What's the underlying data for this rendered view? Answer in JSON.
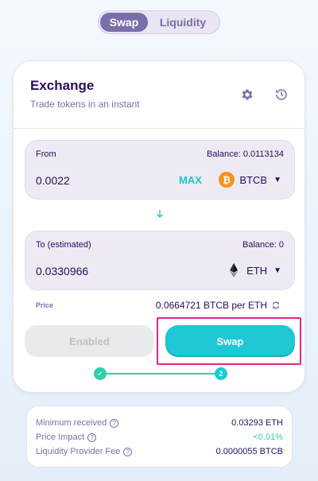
{
  "toggle": {
    "swap_label": "Swap",
    "liquidity_label": "Liquidity",
    "active": "Swap"
  },
  "header": {
    "title": "Exchange",
    "subtitle": "Trade tokens in an instant",
    "icons": [
      "gear-icon",
      "history-icon"
    ]
  },
  "from": {
    "label": "From",
    "balance": "Balance: 0.0113134",
    "amount": "0.0022",
    "max_label": "MAX",
    "token": "BTCB",
    "token_icon": "bitcoin-icon"
  },
  "to": {
    "label": "To (estimated)",
    "balance": "Balance: 0",
    "amount": "0.0330966",
    "token": "ETH",
    "token_icon": "ethereum-icon"
  },
  "price": {
    "label": "Price",
    "value": "0.0664721 BTCB per ETH"
  },
  "buttons": {
    "enabled_label": "Enabled",
    "swap_label": "Swap"
  },
  "stepper": {
    "step1": "✓",
    "step2": "2"
  },
  "details": {
    "min_received_label": "Minimum received",
    "min_received_value": "0.03293 ETH",
    "price_impact_label": "Price Impact",
    "price_impact_value": "<0.01%",
    "lp_fee_label": "Liquidity Provider Fee",
    "lp_fee_value": "0.0000055 BTCB"
  },
  "colors": {
    "accent": "#1fc7d4",
    "primary": "#7a6eaa",
    "text": "#280d5f",
    "success": "#31d0aa",
    "highlight": "#e6248c"
  }
}
